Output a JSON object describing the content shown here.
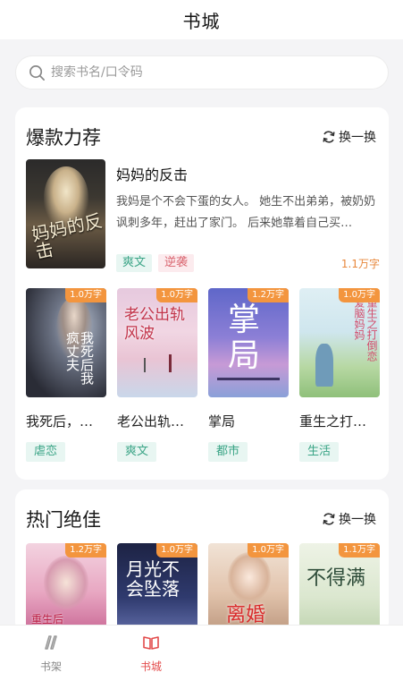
{
  "header": {
    "title": "书城"
  },
  "search": {
    "placeholder": "搜索书名/口令码"
  },
  "section1": {
    "title": "爆款力荐",
    "swap_label": "换一换",
    "featured": {
      "name": "妈妈的反击",
      "cover_title": "妈妈的反击",
      "description": "我妈是个不会下蛋的女人。 她生不出弟弟，被奶奶讽刺多年，赶出了家门。 后来她靠着自己买…",
      "tags": [
        "爽文",
        "逆袭"
      ],
      "word_count": "1.1万字"
    },
    "books": [
      {
        "name": "我死后，…",
        "badge": "1.0万字",
        "tag": "虐恋",
        "cover_title": "我死后我疯丈夫"
      },
      {
        "name": "老公出轨…",
        "badge": "1.0万字",
        "tag": "爽文",
        "cover_title": "老公出轨风波"
      },
      {
        "name": "掌局",
        "badge": "1.2万字",
        "tag": "都市",
        "cover_title": "掌局"
      },
      {
        "name": "重生之打…",
        "badge": "1.0万字",
        "tag": "生活",
        "cover_title": "重生之打倒恋爱脑妈妈"
      }
    ]
  },
  "section2": {
    "title": "热门绝佳",
    "swap_label": "换一换",
    "books": [
      {
        "badge": "1.2万字",
        "cover_title": "重生后"
      },
      {
        "badge": "1.0万字",
        "cover_title": "月光不会坠落"
      },
      {
        "badge": "1.0万字",
        "cover_title": "离婚"
      },
      {
        "badge": "1.1万字",
        "cover_title": "不得满"
      }
    ]
  },
  "tabbar": {
    "items": [
      {
        "label": "书架",
        "icon": "bookshelf-icon"
      },
      {
        "label": "书城",
        "icon": "book-open-icon"
      }
    ]
  },
  "colors": {
    "accent": "#e34b4b",
    "badge": "#f3953e",
    "tag_green": "#3aa486",
    "tag_pink": "#d9646f"
  }
}
